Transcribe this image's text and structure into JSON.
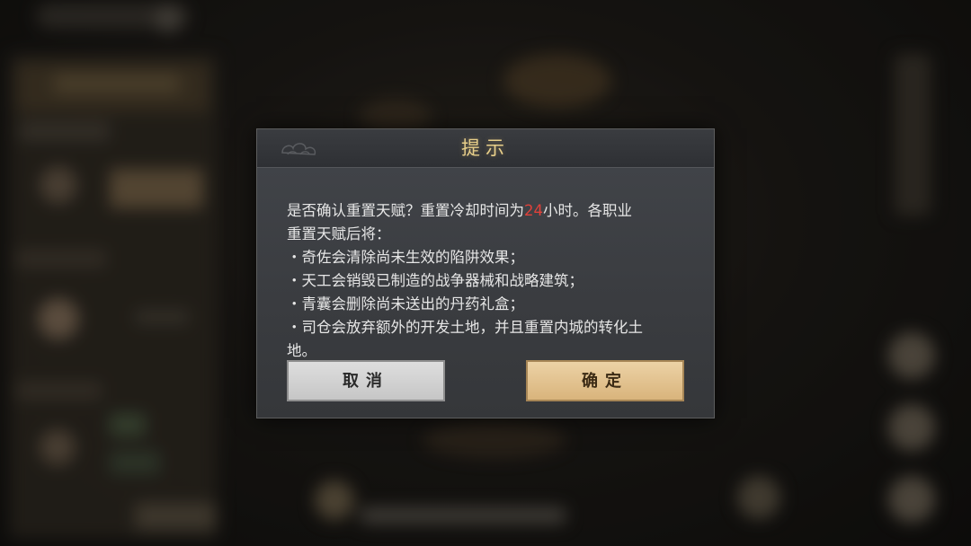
{
  "dialog": {
    "title": "提示",
    "line1_pre": "是否确认重置天赋？重置冷却时间为",
    "line1_highlight": "24",
    "line1_post": "小时。各职业",
    "line2": "重置天赋后将：",
    "bullets": [
      "・奇佐会清除尚未生效的陷阱效果；",
      "・天工会销毁已制造的战争器械和战略建筑；",
      "・青囊会删除尚未送出的丹药礼盒；",
      "・司仓会放弃额外的开发土地，并且重置内城的转化土",
      "地。"
    ],
    "cancel_label": "取消",
    "confirm_label": "确定",
    "highlight_color": "#e0413a",
    "title_color": "#e8cf8a"
  }
}
